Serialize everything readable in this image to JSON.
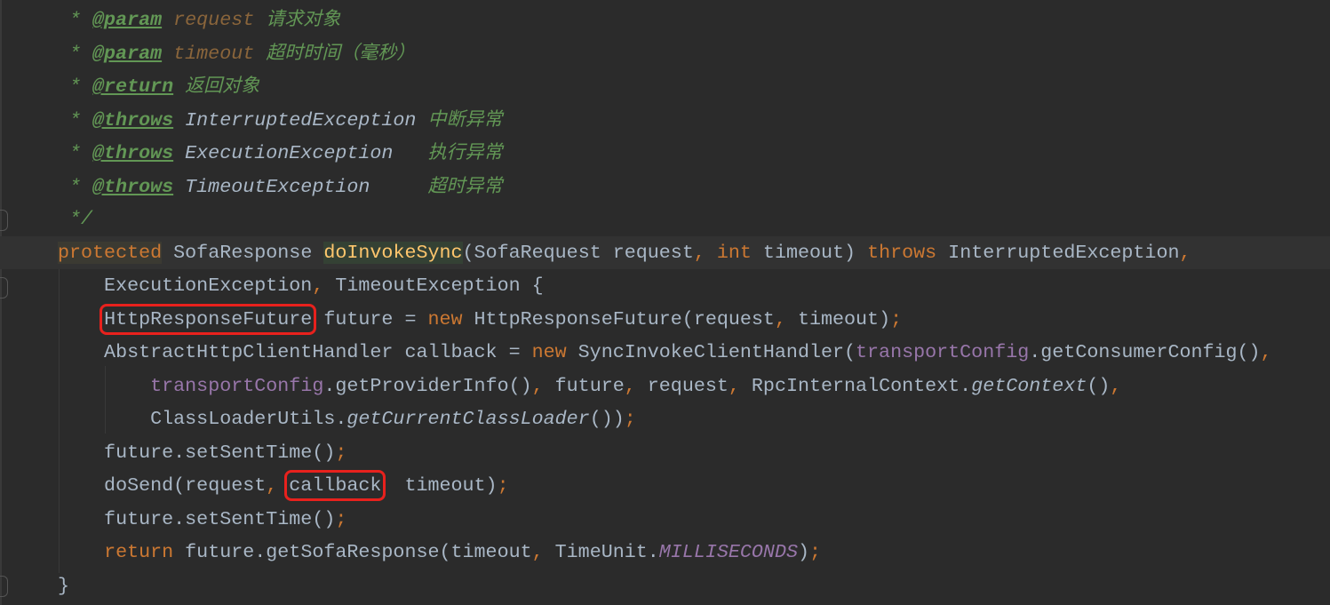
{
  "editor": {
    "current_line_index": 7,
    "annotation_color": "#e8211d",
    "gutter": {
      "intention_icon": "lightbulb-icon"
    },
    "lines": [
      [
        [
          "* ",
          "c"
        ],
        [
          "@param",
          "tag"
        ],
        [
          " ",
          "c"
        ],
        [
          "request",
          "pn"
        ],
        [
          " ",
          "c"
        ],
        [
          "请求对象",
          "cjk"
        ]
      ],
      [
        [
          "* ",
          "c"
        ],
        [
          "@param",
          "tag"
        ],
        [
          " ",
          "c"
        ],
        [
          "timeout",
          "pn"
        ],
        [
          " ",
          "c"
        ],
        [
          "超时时间（毫秒）",
          "cjk"
        ]
      ],
      [
        [
          "* ",
          "c"
        ],
        [
          "@return",
          "tag"
        ],
        [
          " ",
          "c"
        ],
        [
          "返回对象",
          "cjk"
        ]
      ],
      [
        [
          "* ",
          "c"
        ],
        [
          "@throws",
          "tag"
        ],
        [
          " ",
          "c"
        ],
        [
          "InterruptedException",
          "ref"
        ],
        [
          " ",
          "c"
        ],
        [
          "中断异常",
          "cjk"
        ]
      ],
      [
        [
          "* ",
          "c"
        ],
        [
          "@throws",
          "tag"
        ],
        [
          " ",
          "c"
        ],
        [
          "ExecutionException",
          "ref"
        ],
        [
          "   ",
          "c"
        ],
        [
          "执行异常",
          "cjk"
        ]
      ],
      [
        [
          "* ",
          "c"
        ],
        [
          "@throws",
          "tag"
        ],
        [
          " ",
          "c"
        ],
        [
          "TimeoutException",
          "ref"
        ],
        [
          "     ",
          "c"
        ],
        [
          "超时异常",
          "cjk"
        ]
      ],
      [
        [
          "*/",
          "c"
        ]
      ],
      [
        [
          "protected",
          "kw hl-kw"
        ],
        [
          " SofaResponse ",
          "t"
        ],
        [
          "doInvokeSync",
          "fn hl-fn"
        ],
        [
          "(SofaRequest request",
          "t"
        ],
        [
          ", ",
          "p"
        ],
        [
          "int",
          "kw"
        ],
        [
          " timeout) ",
          "t"
        ],
        [
          "throws",
          "kw"
        ],
        [
          " InterruptedException",
          "t"
        ],
        [
          ",",
          "p"
        ]
      ],
      [
        [
          "    ExecutionException",
          "t"
        ],
        [
          ", ",
          "p"
        ],
        [
          "TimeoutException {",
          "t"
        ]
      ],
      [
        [
          "    ",
          "t"
        ],
        [
          "HttpResponseFuture",
          "t box"
        ],
        [
          " future = ",
          "t"
        ],
        [
          "new",
          "kw"
        ],
        [
          " HttpResponseFuture(request",
          "t"
        ],
        [
          ", ",
          "p"
        ],
        [
          "timeout)",
          "t"
        ],
        [
          ";",
          "p"
        ]
      ],
      [
        [
          "    AbstractHttpClientHandler callback = ",
          "t"
        ],
        [
          "new",
          "kw"
        ],
        [
          " SyncInvokeClientHandler(",
          "t"
        ],
        [
          "transportConfig",
          "fld"
        ],
        [
          ".getConsumerConfig()",
          "t"
        ],
        [
          ",",
          "p"
        ]
      ],
      [
        [
          "        ",
          "t"
        ],
        [
          "transportConfig",
          "fld"
        ],
        [
          ".getProviderInfo()",
          "t"
        ],
        [
          ", ",
          "p"
        ],
        [
          "future",
          "t"
        ],
        [
          ", ",
          "p"
        ],
        [
          "request",
          "t"
        ],
        [
          ", ",
          "p"
        ],
        [
          "RpcInternalContext.",
          "t"
        ],
        [
          "getContext",
          "st"
        ],
        [
          "()",
          "t"
        ],
        [
          ",",
          "p"
        ]
      ],
      [
        [
          "        ClassLoaderUtils.",
          "t"
        ],
        [
          "getCurrentClassLoader",
          "st"
        ],
        [
          "())",
          "t"
        ],
        [
          ";",
          "p"
        ]
      ],
      [
        [
          "    future.setSentTime()",
          "t"
        ],
        [
          ";",
          "p"
        ]
      ],
      [
        [
          "    doSend(request",
          "t"
        ],
        [
          ", ",
          "p"
        ],
        [
          "callback",
          "t box"
        ],
        [
          "  timeout)",
          "t"
        ],
        [
          ";",
          "p"
        ]
      ],
      [
        [
          "    future.setSentTime()",
          "t"
        ],
        [
          ";",
          "p"
        ]
      ],
      [
        [
          "    ",
          "t"
        ],
        [
          "return",
          "kw"
        ],
        [
          " future.getSofaResponse(timeout",
          "t"
        ],
        [
          ", ",
          "p"
        ],
        [
          "TimeUnit.",
          "t"
        ],
        [
          "MILLISECONDS",
          "cn"
        ],
        [
          ")",
          "t"
        ],
        [
          ";",
          "p"
        ]
      ],
      [
        [
          "}",
          "t"
        ]
      ]
    ]
  }
}
